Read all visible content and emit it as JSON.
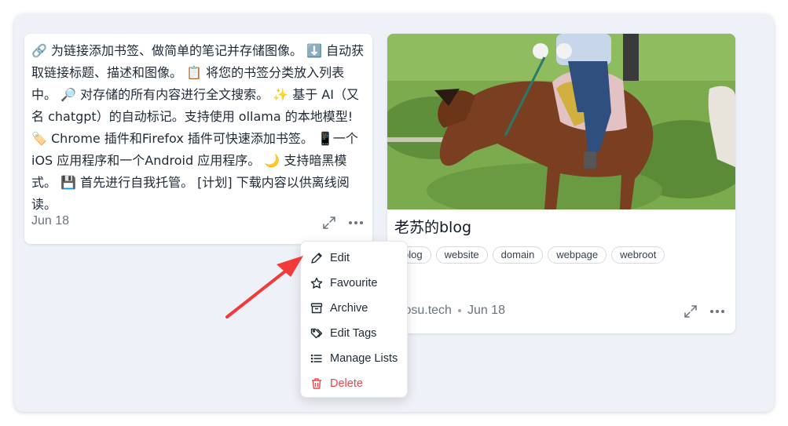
{
  "note_card": {
    "text": "🔗 为链接添加书签、做简单的笔记并存储图像。 ⬇️ 自动获取链接标题、描述和图像。 📋 将您的书签分类放入列表中。 🔎 对存储的所有内容进行全文搜索。 ✨ 基于 AI（又名 chatgpt）的自动标记。支持使用 ollama 的本地模型! 🏷️ Chrome 插件和Firefox 插件可快速添加书签。 📱一个 iOS 应用程序和一个Android 应用程序。 🌙 支持暗黑模式。 💾 首先进行自我托管。 [计划] 下载内容以供离线阅读。",
    "date": "Jun 18",
    "expand_icon": "expand-icon",
    "more_icon": "more-icon"
  },
  "link_card": {
    "title": "老苏的blog",
    "tags": [
      "blog",
      "website",
      "domain",
      "webpage",
      "webroot"
    ],
    "domain": "laosu.tech",
    "date": "Jun 18",
    "image_subject": "children riding a brown horse on grass"
  },
  "menu": {
    "items": [
      {
        "label": "Edit",
        "icon": "pencil-icon"
      },
      {
        "label": "Favourite",
        "icon": "star-icon"
      },
      {
        "label": "Archive",
        "icon": "archive-icon"
      },
      {
        "label": "Edit Tags",
        "icon": "tags-icon"
      },
      {
        "label": "Manage Lists",
        "icon": "list-icon"
      },
      {
        "label": "Delete",
        "icon": "trash-icon"
      }
    ]
  },
  "colors": {
    "background": "#eef1f7",
    "card": "#ffffff",
    "danger": "#e5484d",
    "annotation_arrow": "#f23a3a"
  }
}
